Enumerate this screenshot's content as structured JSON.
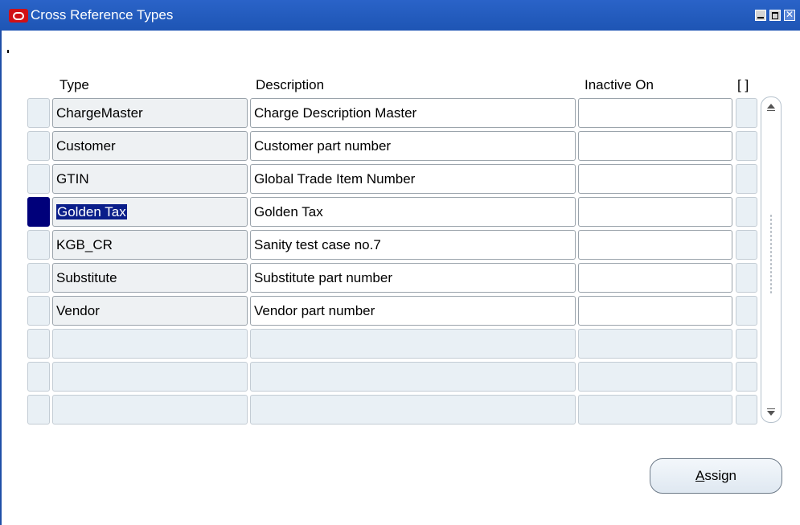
{
  "window": {
    "title": "Cross Reference Types",
    "logo_icon": "oracle-logo-icon",
    "controls": [
      "minimize-icon",
      "maximize-icon",
      "close-icon"
    ],
    "close_glyph": "✕"
  },
  "table": {
    "headers": {
      "type": "Type",
      "description": "Description",
      "inactive_on": "Inactive On",
      "flex": "[ ]"
    },
    "rows": [
      {
        "type": "ChargeMaster",
        "description": "Charge Description Master",
        "inactive_on": "",
        "selected": false
      },
      {
        "type": "Customer",
        "description": "Customer part number",
        "inactive_on": "",
        "selected": false
      },
      {
        "type": "GTIN",
        "description": "Global Trade Item Number",
        "inactive_on": "",
        "selected": false
      },
      {
        "type": "Golden Tax",
        "description": "Golden Tax",
        "inactive_on": "",
        "selected": true
      },
      {
        "type": "KGB_CR",
        "description": "Sanity test case no.7",
        "inactive_on": "",
        "selected": false
      },
      {
        "type": "Substitute",
        "description": "Substitute part number",
        "inactive_on": "",
        "selected": false
      },
      {
        "type": "Vendor",
        "description": "Vendor part number",
        "inactive_on": "",
        "selected": false
      },
      {
        "type": "",
        "description": "",
        "inactive_on": "",
        "selected": false
      },
      {
        "type": "",
        "description": "",
        "inactive_on": "",
        "selected": false
      },
      {
        "type": "",
        "description": "",
        "inactive_on": "",
        "selected": false
      }
    ]
  },
  "buttons": {
    "assign": {
      "mnemonic": "A",
      "rest": "ssign"
    }
  },
  "colors": {
    "titlebar": "#2a63c8",
    "selection": "#00007a",
    "cell_readonly": "#eef1f3",
    "cell_empty": "#e9f0f5"
  }
}
